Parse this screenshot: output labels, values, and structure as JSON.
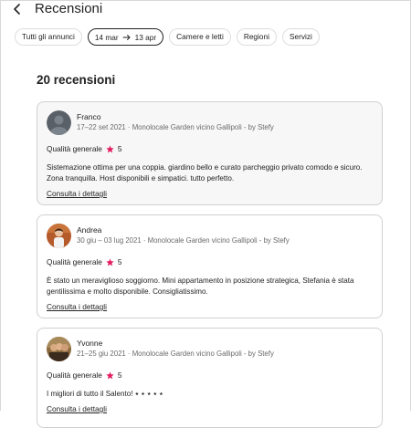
{
  "header": {
    "title": "Recensioni",
    "back_icon": "chevron-left-icon"
  },
  "filters": [
    {
      "label": "Tutti gli annunci",
      "active": false
    },
    {
      "label_from": "14 mar",
      "label_to": "13 apr",
      "active": true
    },
    {
      "label": "Camere e letti",
      "active": false
    },
    {
      "label": "Regioni",
      "active": false
    },
    {
      "label": "Servizi",
      "active": false
    }
  ],
  "reviews_count": "20 recensioni",
  "colors": {
    "star": "#e31c5f",
    "text": "#222222",
    "muted": "#6a6a6a"
  },
  "reviews": [
    {
      "name": "Franco",
      "stay": "17–22 set 2021 · Monolocale Garden vicino Gallipoli - by Stefy",
      "rating_label": "Qualità generale",
      "rating": "5",
      "text": "Sistemazione ottima per una coppia. giardino bello e curato parcheggio privato comodo e sicuro. Zona tranquilla. Host disponibili e simpatici. tutto perfetto.",
      "details_label": "Consulta i dettagli"
    },
    {
      "name": "Andrea",
      "stay": "30 giu – 03 lug 2021 · Monolocale Garden vicino Gallipoli - by Stefy",
      "rating_label": "Qualità generale",
      "rating": "5",
      "text": "È stato un meraviglioso soggiorno. Mini appartamento in posizione strategica, Stefania è stata gentilissima e molto disponibile. Consigliatissimo.",
      "details_label": "Consulta i dettagli"
    },
    {
      "name": "Yvonne",
      "stay": "21–25 giu 2021 · Monolocale Garden vicino Gallipoli - by Stefy",
      "rating_label": "Qualità generale",
      "rating": "5",
      "text": "I migliori di tutto il Salento! ⭑ ⭑ ⭑ ⭑ ⭑",
      "details_label": "Consulta i dettagli"
    }
  ]
}
